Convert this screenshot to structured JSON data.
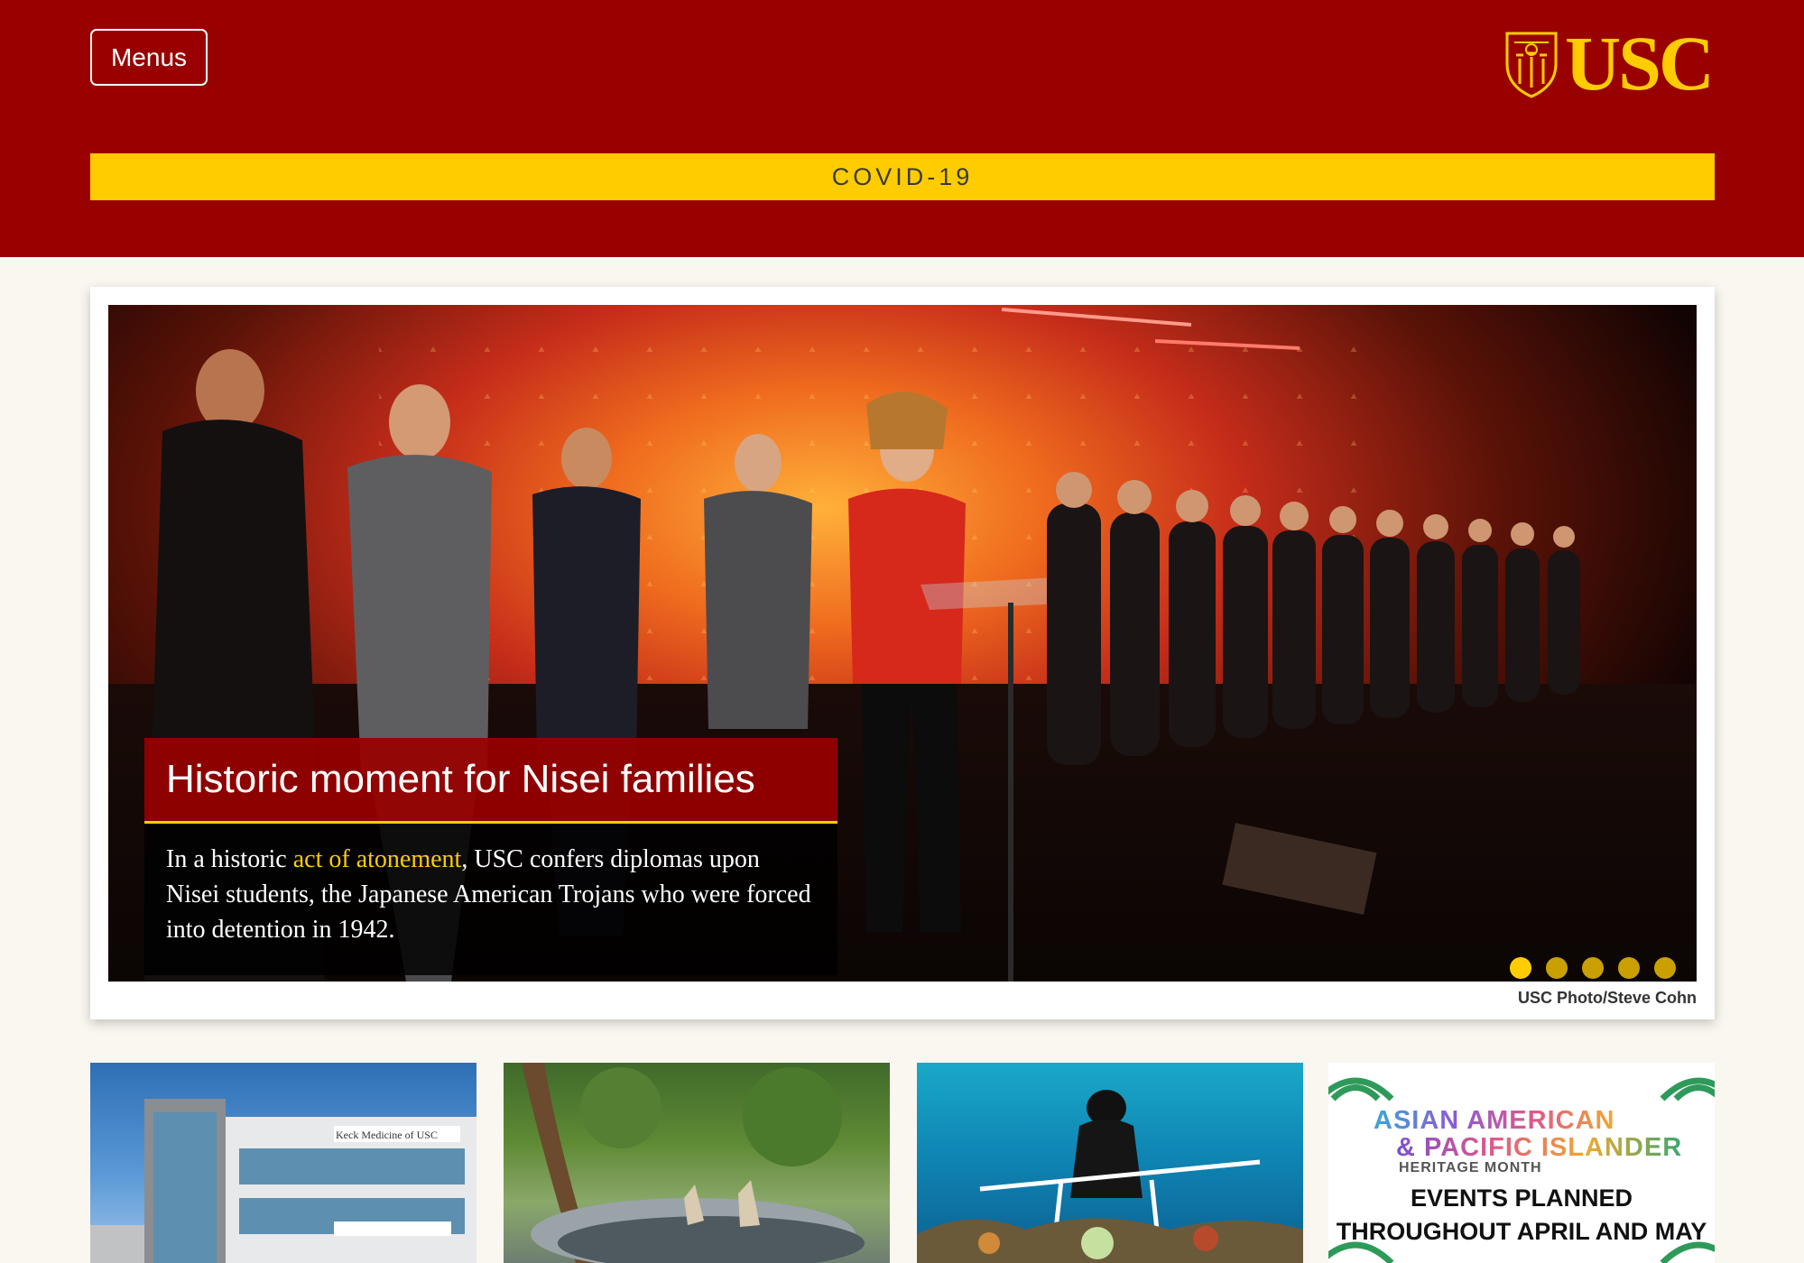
{
  "header": {
    "menus_label": "Menus",
    "logo_text": "USC",
    "alert_label": "COVID-19"
  },
  "hero": {
    "title": "Historic moment for Nisei families",
    "body_prefix": "In a historic ",
    "body_link": "act of atonement",
    "body_suffix": ", USC confers diplomas upon Nisei students, the Japanese American Trojans who were forced into detention in 1942.",
    "photo_credit": "USC Photo/Steve Cohn",
    "slide_count": 5,
    "active_slide": 1
  },
  "tiles": [
    {
      "name": "keck-medicine-building",
      "sign": "Keck Medicine of USC"
    },
    {
      "name": "garden-fountain"
    },
    {
      "name": "scuba-diver-coral"
    },
    {
      "name": "aapi-heritage",
      "line1": "ASIAN AMERICAN",
      "line2": "& PACIFIC ISLANDER",
      "line3": "HERITAGE MONTH",
      "events": "EVENTS PLANNED THROUGHOUT APRIL AND MAY"
    }
  ],
  "colors": {
    "cardinal": "#990000",
    "gold": "#ffcc00",
    "page_bg": "#f9f7ef"
  }
}
